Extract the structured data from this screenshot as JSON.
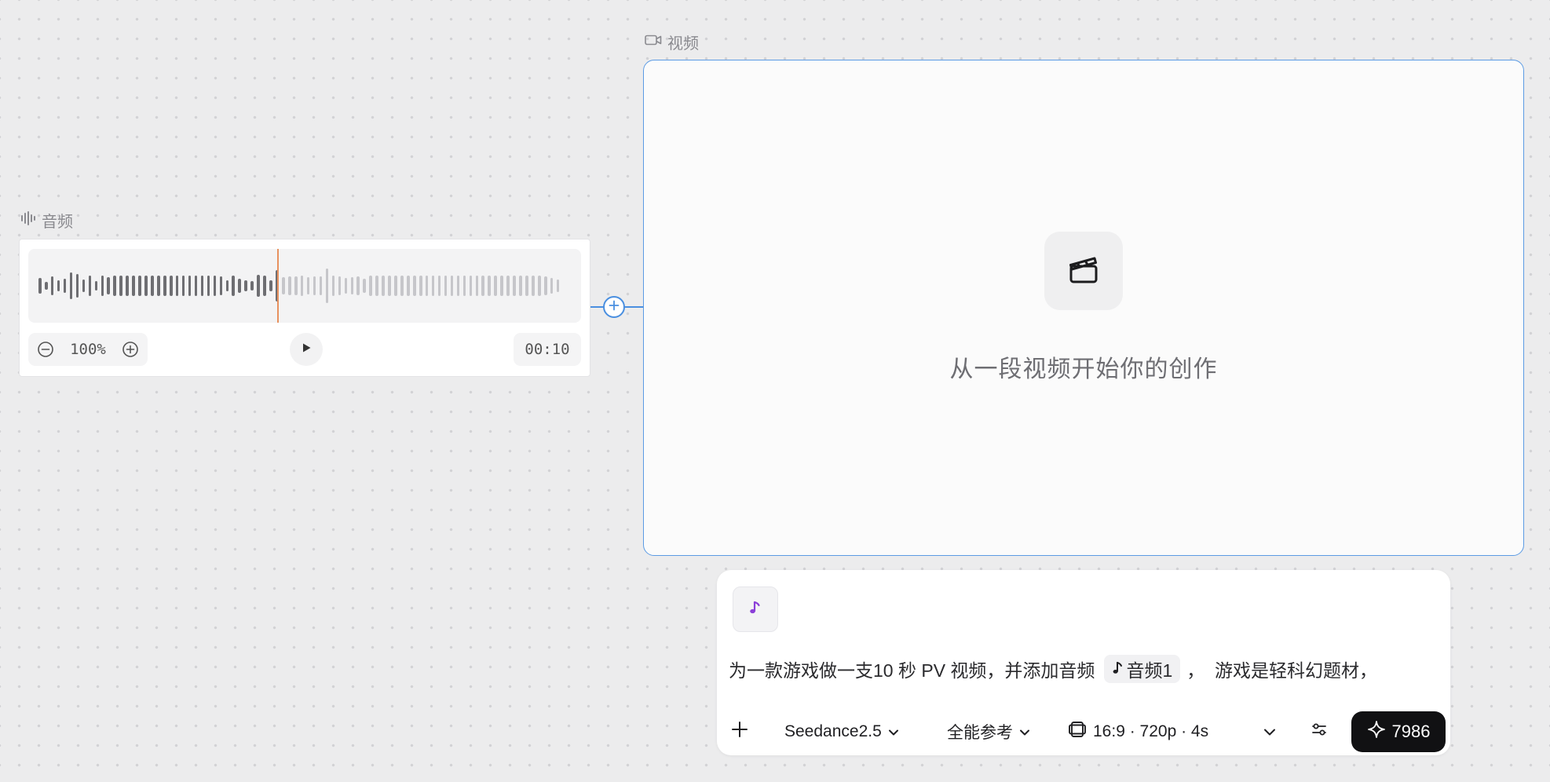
{
  "audio_node": {
    "label": "音频",
    "zoom": "100%",
    "duration": "00:10",
    "playhead_fraction": 0.44
  },
  "video_node": {
    "label": "视频",
    "placeholder": "从一段视频开始你的创作"
  },
  "prompt": {
    "text_before": "为一款游戏做一支10 秒 PV 视频，并添加音频",
    "audio_chip_label": "音频1",
    "text_after": "，  游戏是轻科幻题材，"
  },
  "toolbar": {
    "model": "Seedance2.5",
    "mode": "全能参考",
    "settings": "16:9 · 720p · 4s",
    "credits": "7986"
  },
  "colors": {
    "accent_blue": "#4a8fe0",
    "playhead_orange": "#e8915e",
    "music_purple": "#8b3fd8",
    "button_dark": "#111113"
  }
}
